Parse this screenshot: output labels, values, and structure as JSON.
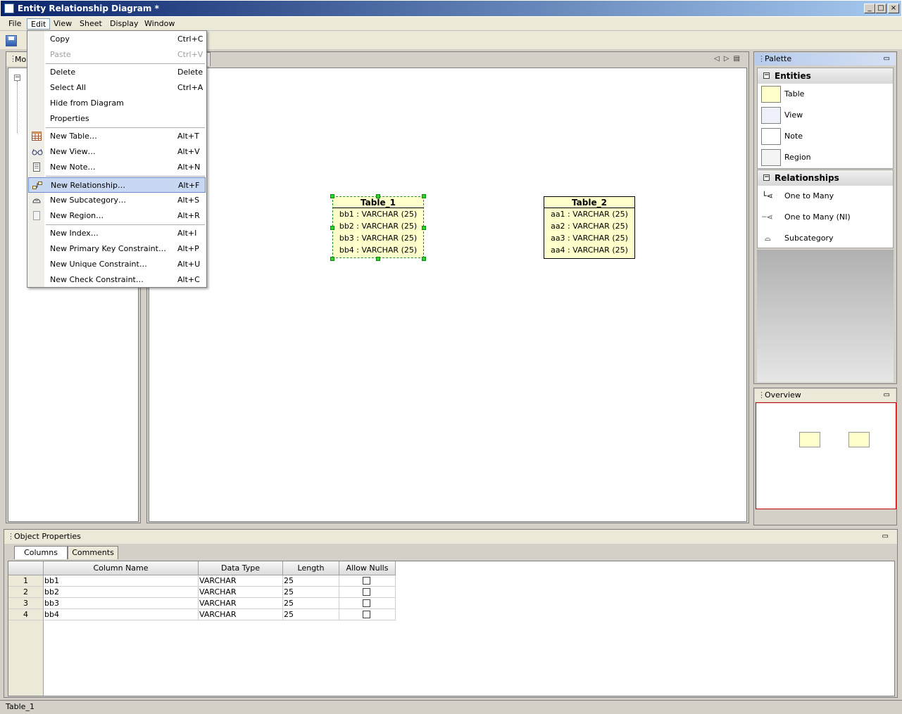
{
  "window": {
    "title": "Entity Relationship Diagram *"
  },
  "menubar": [
    "File",
    "Edit",
    "View",
    "Sheet",
    "Display",
    "Window"
  ],
  "model_panel": {
    "title": "Mo"
  },
  "edit_menu": [
    {
      "label": "Copy",
      "shortcut": "Ctrl+C",
      "disabled": false
    },
    {
      "label": "Paste",
      "shortcut": "Ctrl+V",
      "disabled": true
    },
    {
      "label": "Delete",
      "shortcut": "Delete"
    },
    {
      "label": "Select All",
      "shortcut": "Ctrl+A"
    },
    {
      "label": "Hide from Diagram",
      "shortcut": ""
    },
    {
      "label": "Properties",
      "shortcut": ""
    },
    {
      "label": "New Table…",
      "shortcut": "Alt+T",
      "icon": "table-icon"
    },
    {
      "label": "New View…",
      "shortcut": "Alt+V",
      "icon": "view-glasses-icon"
    },
    {
      "label": "New Note…",
      "shortcut": "Alt+N",
      "icon": "note-icon"
    },
    {
      "label": "New Relationship…",
      "shortcut": "Alt+F",
      "icon": "relationship-icon",
      "highlighted": true
    },
    {
      "label": "New Subcategory…",
      "shortcut": "Alt+S",
      "icon": "subcategory-icon"
    },
    {
      "label": "New Region…",
      "shortcut": "Alt+R",
      "icon": "region-icon"
    },
    {
      "label": "New Index…",
      "shortcut": "Alt+I"
    },
    {
      "label": "New Primary Key Constraint…",
      "shortcut": "Alt+P"
    },
    {
      "label": "New Unique Constraint…",
      "shortcut": "Alt+U"
    },
    {
      "label": "New Check Constraint…",
      "shortcut": "Alt+C"
    }
  ],
  "diagram": {
    "table1": {
      "name": "Table_1",
      "columns": [
        "bb1 : VARCHAR (25)",
        "bb2 : VARCHAR (25)",
        "bb3 : VARCHAR (25)",
        "bb4 : VARCHAR (25)"
      ]
    },
    "table2": {
      "name": "Table_2",
      "columns": [
        "aa1 : VARCHAR (25)",
        "aa2 : VARCHAR (25)",
        "aa3 : VARCHAR (25)",
        "aa4 : VARCHAR (25)"
      ]
    }
  },
  "palette": {
    "title": "Palette",
    "entities_header": "Entities",
    "entities": [
      "Table",
      "View",
      "Note",
      "Region"
    ],
    "relationships_header": "Relationships",
    "relationships": [
      "One to Many",
      "One to Many (NI)",
      "Subcategory"
    ]
  },
  "overview": {
    "title": "Overview"
  },
  "object_properties": {
    "title": "Object Properties",
    "tabs": [
      "Columns",
      "Comments"
    ],
    "headers": [
      "Column Name",
      "Data Type",
      "Length",
      "Allow Nulls"
    ],
    "rows": [
      {
        "n": "1",
        "name": "bb1",
        "type": "VARCHAR",
        "length": "25"
      },
      {
        "n": "2",
        "name": "bb2",
        "type": "VARCHAR",
        "length": "25"
      },
      {
        "n": "3",
        "name": "bb3",
        "type": "VARCHAR",
        "length": "25"
      },
      {
        "n": "4",
        "name": "bb4",
        "type": "VARCHAR",
        "length": "25"
      }
    ]
  },
  "status": "Table_1"
}
